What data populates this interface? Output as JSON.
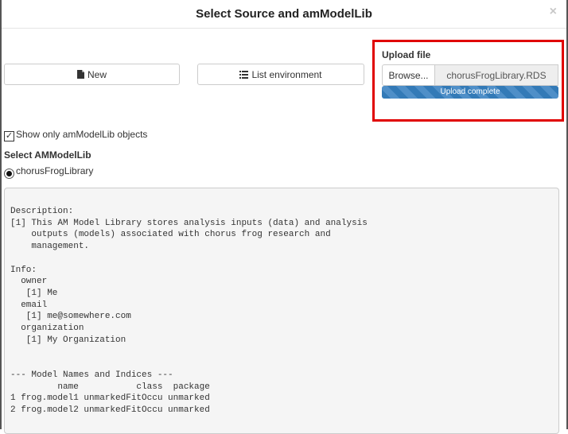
{
  "modal": {
    "title": "Select Source and amModelLib",
    "close": "×"
  },
  "buttons": {
    "new_label": "New",
    "new_icon": "file-icon",
    "list_label": "List environment",
    "list_icon": "list-icon"
  },
  "upload": {
    "label": "Upload file",
    "browse_label": "Browse...",
    "filename": "chorusFrogLibrary.RDS",
    "progress_text": "Upload complete",
    "progress_percent": 100,
    "progress_color": "#337ab7",
    "highlight_color": "#e00000"
  },
  "checkbox": {
    "label": "Show only amModelLib objects",
    "checked": true
  },
  "select": {
    "label": "Select AMModelLib",
    "options": [
      {
        "label": "chorusFrogLibrary",
        "selected": true
      }
    ]
  },
  "output": {
    "text": "Description:\n[1] This AM Model Library stores analysis inputs (data) and analysis\n    outputs (models) associated with chorus frog research and\n    management.\n\nInfo:\n  owner\n   [1] Me\n  email\n   [1] me@somewhere.com\n  organization\n   [1] My Organization\n\n\n--- Model Names and Indices ---\n         name           class  package\n1 frog.model1 unmarkedFitOccu unmarked\n2 frog.model2 unmarkedFitOccu unmarked"
  }
}
